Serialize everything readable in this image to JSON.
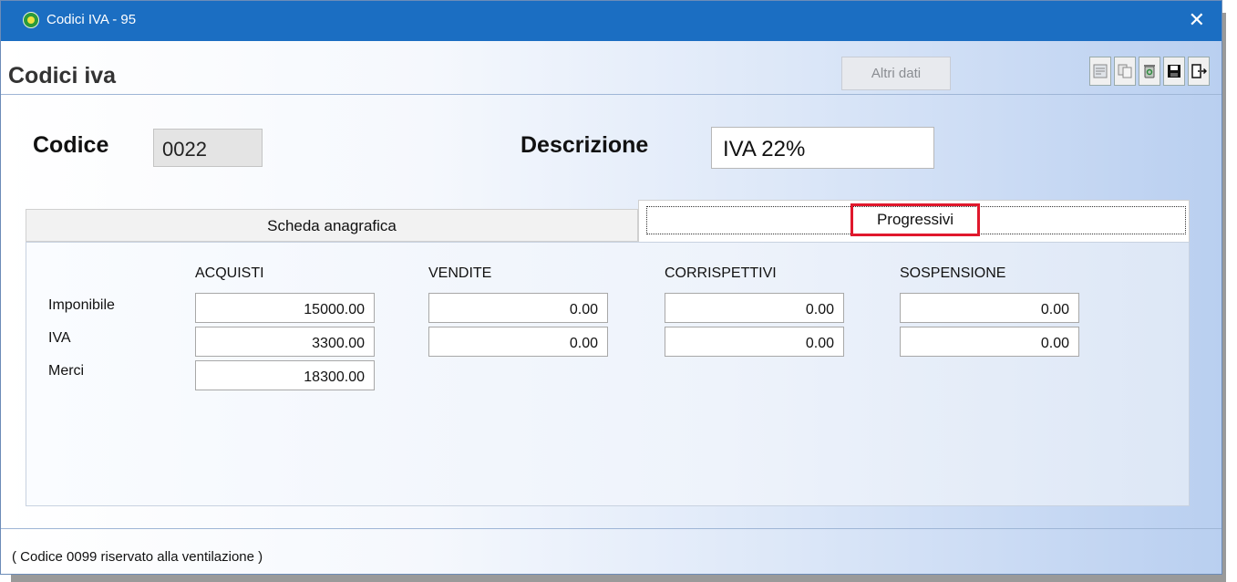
{
  "window": {
    "title": "Codici IVA - 95",
    "close_glyph": "✕"
  },
  "header": {
    "title": "Codici iva",
    "altri_dati_label": "Altri dati",
    "toolbar_icons": [
      "print-preview-icon",
      "copy-document-icon",
      "recycle-bin-icon",
      "save-disk-icon",
      "exit-door-icon"
    ]
  },
  "form": {
    "codice_label": "Codice",
    "codice_value": "0022",
    "descrizione_label": "Descrizione",
    "descrizione_value": "IVA 22%"
  },
  "tabs": [
    {
      "label": "Scheda anagrafica",
      "active": false
    },
    {
      "label": "Progressivi",
      "active": true
    }
  ],
  "progressivi": {
    "columns": [
      "ACQUISTI",
      "VENDITE",
      "CORRISPETTIVI",
      "SOSPENSIONE"
    ],
    "rows": [
      {
        "label": "Imponibile",
        "values": [
          "15000.00",
          "0.00",
          "0.00",
          "0.00"
        ]
      },
      {
        "label": "IVA",
        "values": [
          "3300.00",
          "0.00",
          "0.00",
          "0.00"
        ]
      },
      {
        "label": "Merci",
        "values": [
          "18300.00"
        ]
      }
    ]
  },
  "footer": {
    "note": "( Codice 0099 riservato alla ventilazione )"
  },
  "colors": {
    "titlebar": "#1b6ec2",
    "highlight_border": "#e0182c"
  }
}
